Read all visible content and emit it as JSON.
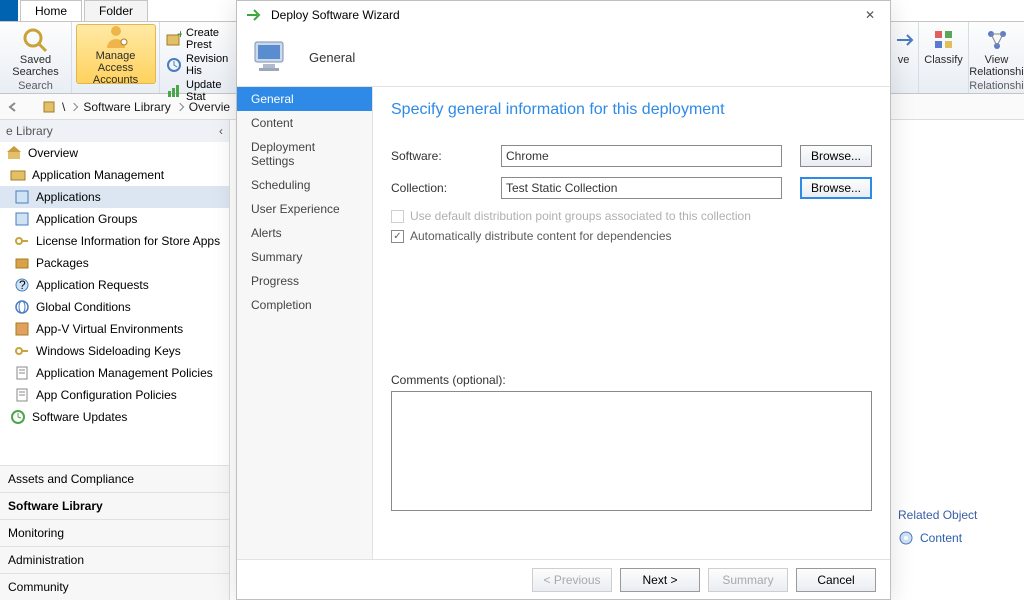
{
  "tabs": {
    "home": "Home",
    "folder": "Folder"
  },
  "ribbon": {
    "search_group": "Search",
    "saved_searches": "Saved\nSearches",
    "manage_access": "Manage Access\nAccounts",
    "create_prestaged": "Create Prest",
    "revision_history": "Revision His",
    "update_stats": "Update Stat",
    "move": "ve",
    "classify": "Classify",
    "view_rel": "View\nRelationshi",
    "rel_group": "Relationshi"
  },
  "breadcrumb": [
    "\\",
    "Software Library",
    "Overvie"
  ],
  "nav_header": "e Library",
  "tree": [
    {
      "lvl": 1,
      "label": "Overview",
      "icon": "home"
    },
    {
      "lvl": 2,
      "label": "Application Management",
      "icon": "folder"
    },
    {
      "lvl": 3,
      "label": "Applications",
      "icon": "app",
      "sel": true
    },
    {
      "lvl": 3,
      "label": "Application Groups",
      "icon": "app"
    },
    {
      "lvl": 3,
      "label": "License Information for Store Apps",
      "icon": "key"
    },
    {
      "lvl": 3,
      "label": "Packages",
      "icon": "pkg"
    },
    {
      "lvl": 3,
      "label": "Application Requests",
      "icon": "req"
    },
    {
      "lvl": 3,
      "label": "Global Conditions",
      "icon": "globe"
    },
    {
      "lvl": 3,
      "label": "App-V Virtual Environments",
      "icon": "appv"
    },
    {
      "lvl": 3,
      "label": "Windows Sideloading Keys",
      "icon": "key"
    },
    {
      "lvl": 3,
      "label": "Application Management Policies",
      "icon": "policy"
    },
    {
      "lvl": 3,
      "label": "App Configuration Policies",
      "icon": "policy"
    },
    {
      "lvl": 2,
      "label": "Software Updates",
      "icon": "update"
    }
  ],
  "sections": [
    "Assets and Compliance",
    "Software Library",
    "Monitoring",
    "Administration",
    "Community"
  ],
  "active_section": 1,
  "wizard": {
    "title": "Deploy Software Wizard",
    "header": "General",
    "steps": [
      "General",
      "Content",
      "Deployment Settings",
      "Scheduling",
      "User Experience",
      "Alerts",
      "Summary",
      "Progress",
      "Completion"
    ],
    "active_step": 0,
    "heading": "Specify general information for this deployment",
    "software_label": "Software:",
    "software_value": "Chrome",
    "collection_label": "Collection:",
    "collection_value": "Test Static Collection",
    "browse": "Browse...",
    "chk1": "Use default distribution point groups associated to this collection",
    "chk2": "Automatically distribute content for dependencies",
    "comments_label": "Comments (optional):",
    "btn_prev": "< Previous",
    "btn_next": "Next >",
    "btn_summary": "Summary",
    "btn_cancel": "Cancel"
  },
  "right": {
    "related_hdr": "Related Object",
    "content_link": "Content"
  }
}
